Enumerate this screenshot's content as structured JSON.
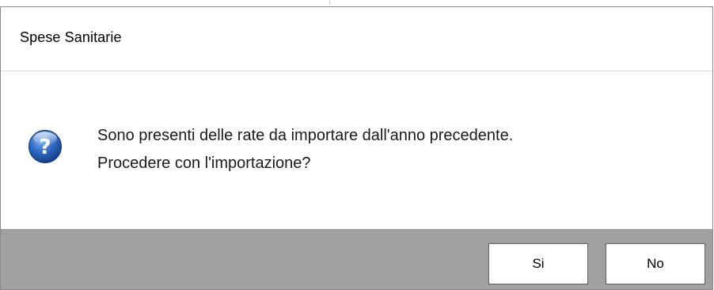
{
  "dialog": {
    "title": "Spese Sanitarie",
    "icon": "question-icon",
    "message_line_1": "Sono presenti delle rate da importare dall'anno precedente.",
    "message_line_2": "Procedere con l'importazione?",
    "buttons": {
      "yes_label": "Si",
      "no_label": "No"
    }
  },
  "colors": {
    "button_bar": "#a0a0a0",
    "icon_blue": "#2a5db0",
    "background": "#ffffff"
  }
}
